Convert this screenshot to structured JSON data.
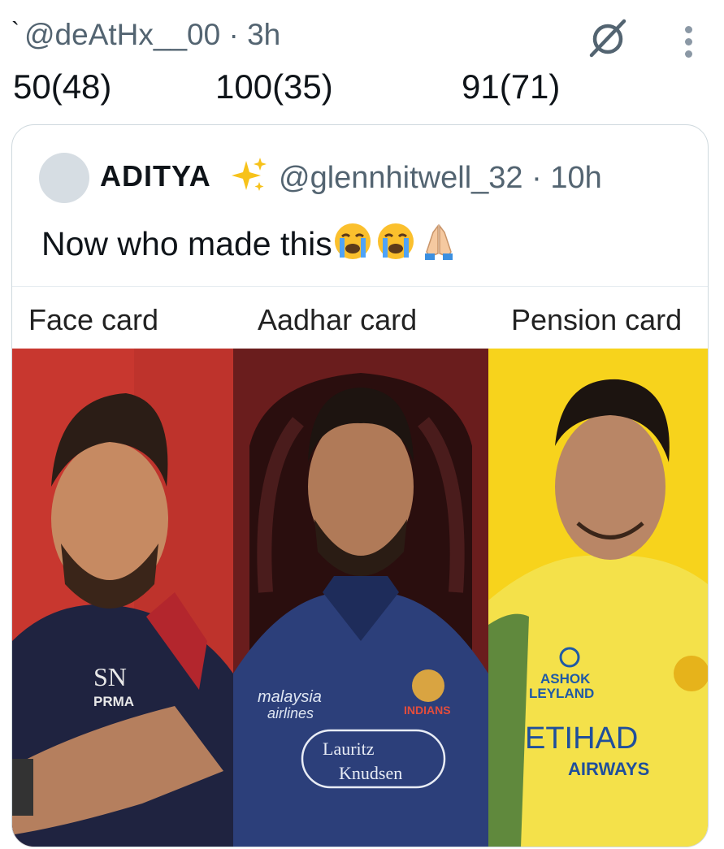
{
  "tweet": {
    "handle": "@deAtHx__00",
    "time": "3h",
    "scores": [
      "50(48)",
      "100(35)",
      "91(71)"
    ],
    "header_icons": [
      "no-circle-icon",
      "more-vertical-icon"
    ]
  },
  "quote": {
    "name": "ADITYA",
    "name_emoji": "sparkles-icon",
    "handle": "@glennhitwell_32",
    "time": "10h",
    "text": "Now who made this",
    "text_emojis": [
      "crying-face-icon",
      "crying-face-icon",
      "folded-hands-icon"
    ]
  },
  "media": {
    "labels": [
      "Face card",
      "Aadhar card",
      "Pension card"
    ],
    "panels": [
      {
        "background": "#c8372f",
        "jersey": "#1f2340",
        "shirt_text": [
          "PRMA"
        ],
        "logo": "SN"
      },
      {
        "background": "#6a1d1d",
        "jersey": "#2c3f7a",
        "shirt_text": [
          "malaysia",
          "airlines",
          "INDIANS",
          "Lauritz",
          "Knudsen"
        ]
      },
      {
        "background": "#f7d31c",
        "jersey": "#f4e14a",
        "shirt_text": [
          "ASHOK",
          "LEYLAND",
          "ETIHAD",
          "AIRWAYS"
        ]
      }
    ]
  }
}
